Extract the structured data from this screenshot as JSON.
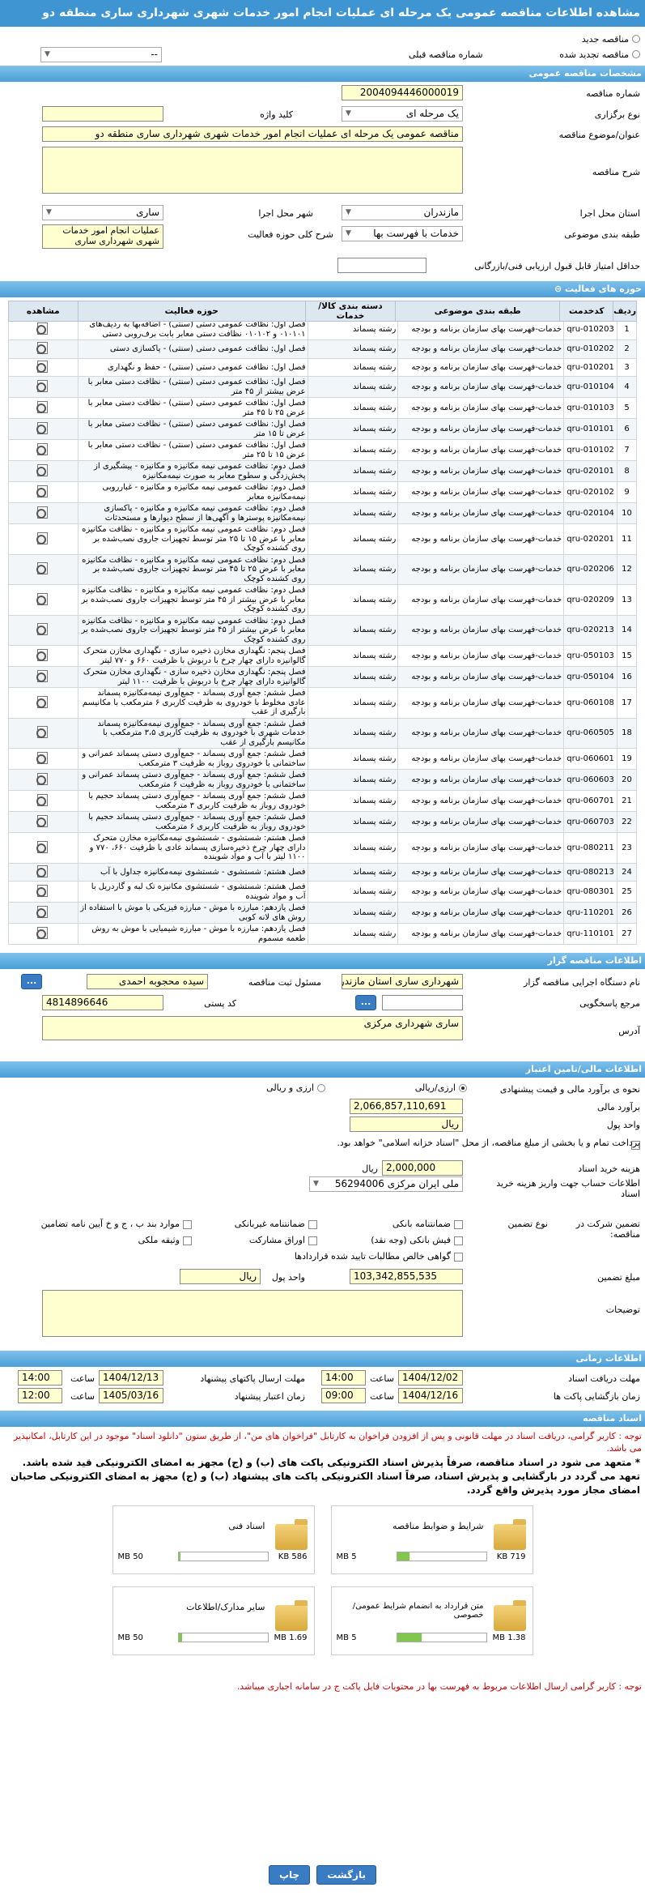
{
  "header": {
    "title": "مشاهده اطلاعات مناقصه عمومی یک مرحله ای عملیات انجام امور خدمات شهری شهرداری ساری منطقه دو"
  },
  "top": {
    "new_label": "مناقصه جدید",
    "renewed_label": "مناقصه تجدید شده",
    "prev_label": "شماره مناقصه قبلی",
    "prev_value": "--"
  },
  "general": {
    "section": "مشخصات مناقصه عمومی",
    "number_label": "شماره مناقصه",
    "number": "2004094446000019",
    "type_label": "نوع برگزاری",
    "type": "یک مرحله ای",
    "keyword_label": "کلید واژه",
    "subject_label": "عنوان/موضوع مناقصه",
    "subject": "مناقصه عمومی یک مرحله ای عملیات انجام امور خدمات شهری شهرداری ساری منطقه دو",
    "desc_label": "شرح مناقصه",
    "province_label": "استان محل اجرا",
    "province": "مازندران",
    "city_label": "شهر محل اجرا",
    "city": "ساری",
    "category_label": "طبقه بندی موضوعی",
    "category": "خدمات با فهرست بها",
    "scope_label": "شرح کلی حوزه فعالیت",
    "scope": "عملیات انجام امور خدمات شهری شهرداری ساری",
    "score_label": "حداقل امتیاز قابل قبول ارزیابی فنی/بازرگانی"
  },
  "activities": {
    "section": "حوزه های فعالیت",
    "headers": [
      "ردیف",
      "کدخدمت",
      "طبقه بندی موضوعی",
      "دسته بندی کالا/خدمات",
      "حوزه فعالیت",
      "مشاهده"
    ],
    "rows": [
      [
        "1",
        "qru-010203",
        "خدمات-فهرست بهای سازمان برنامه و بودجه",
        "رشته پسماند",
        "فصل اول: نظافت عمومی دستی (سنتی) - اضافه‌بها به ردیف‌های ۰۱۰۱۰۱ و ۰۱۰۱۰۲ نظافت دستی معابر بابت برف‌روبی دستی"
      ],
      [
        "2",
        "qru-010202",
        "خدمات-فهرست بهای سازمان برنامه و بودجه",
        "رشته پسماند",
        "فصل اول: نظافت عمومی دستی (سنتی) - پاکسازی دستی"
      ],
      [
        "3",
        "qru-010201",
        "خدمات-فهرست بهای سازمان برنامه و بودجه",
        "رشته پسماند",
        "فصل اول: نظافت عمومی دستی (سنتی) - حفظ و نگهداری"
      ],
      [
        "4",
        "qru-010104",
        "خدمات-فهرست بهای سازمان برنامه و بودجه",
        "رشته پسماند",
        "فصل اول: نظافت عمومی دستی (سنتی) - نظافت دستی معابر با عرض بیشتر از ۴۵ متر"
      ],
      [
        "5",
        "qru-010103",
        "خدمات-فهرست بهای سازمان برنامه و بودجه",
        "رشته پسماند",
        "فصل اول: نظافت عمومی دستی (سنتی) - نظافت دستی معابر با عرض ۲۵ تا ۴۵ متر"
      ],
      [
        "6",
        "qru-010101",
        "خدمات-فهرست بهای سازمان برنامه و بودجه",
        "رشته پسماند",
        "فصل اول: نظافت عمومی دستی (سنتی) - نظافت دستی معابر با عرض تا ۱۵ متر"
      ],
      [
        "7",
        "qru-010102",
        "خدمات-فهرست بهای سازمان برنامه و بودجه",
        "رشته پسماند",
        "فصل اول: نظافت عمومی دستی (سنتی) - نظافت دستی معابر با عرض ۱۵ تا ۲۵ متر"
      ],
      [
        "8",
        "qru-020101",
        "خدمات-فهرست بهای سازمان برنامه و بودجه",
        "رشته پسماند",
        "فصل دوم: نظافت عمومی نیمه مکانیزه و مکانیزه - پیشگیری از پخش‌زدگی و سطوح معابر به صورت نیمه‌مکانیزه"
      ],
      [
        "9",
        "qru-020102",
        "خدمات-فهرست بهای سازمان برنامه و بودجه",
        "رشته پسماند",
        "فصل دوم: نظافت عمومی نیمه مکانیزه و مکانیزه - غبارروبی نیمه‌مکانیزه معابر"
      ],
      [
        "10",
        "qru-020104",
        "خدمات-فهرست بهای سازمان برنامه و بودجه",
        "رشته پسماند",
        "فصل دوم: نظافت عمومی نیمه مکانیزه و مکانیزه - پاکسازی نیمه‌مکانیزه پوسترها و آگهی‌ها از سطح دیوارها و مستحدثات"
      ],
      [
        "11",
        "qru-020201",
        "خدمات-فهرست بهای سازمان برنامه و بودجه",
        "رشته پسماند",
        "فصل دوم: نظافت عمومی نیمه مکانیزه و مکانیزه - نظافت مکانیزه معابر با عرض ۱۵ تا ۲۵ متر توسط تجهیزات جاروی نصب‌شده بر روی کشنده کوچک"
      ],
      [
        "12",
        "qru-020206",
        "خدمات-فهرست بهای سازمان برنامه و بودجه",
        "رشته پسماند",
        "فصل دوم: نظافت عمومی نیمه مکانیزه و مکانیزه - نظافت مکانیزه معابر با عرض ۲۵ تا ۴۵ متر توسط تجهیزات جاروی نصب‌شده بر روی کشنده کوچک"
      ],
      [
        "13",
        "qru-020209",
        "خدمات-فهرست بهای سازمان برنامه و بودجه",
        "رشته پسماند",
        "فصل دوم: نظافت عمومی نیمه مکانیزه و مکانیزه - نظافت مکانیزه معابر با عرض بیشتر از ۴۵ متر توسط تجهیزات جاروی نصب‌شده بر روی کشنده کوچک"
      ],
      [
        "14",
        "qru-020213",
        "خدمات-فهرست بهای سازمان برنامه و بودجه",
        "رشته پسماند",
        "فصل دوم: نظافت عمومی نیمه مکانیزه و مکانیزه - نظافت مکانیزه معابر با عرض بیشتر از ۴۵ متر توسط تجهیزات جاروی نصب‌شده بر روی کشنده کوچک"
      ],
      [
        "15",
        "qru-050103",
        "خدمات-فهرست بهای سازمان برنامه و بودجه",
        "رشته پسماند",
        "فصل پنجم: نگهداری مخازن ذخیره سازی - نگهداری مخازن متحرک گالوانیزه دارای چهار چرخ با دربوش با ظرفیت ۶۶۰ و ۷۷۰ لیتر"
      ],
      [
        "16",
        "qru-050104",
        "خدمات-فهرست بهای سازمان برنامه و بودجه",
        "رشته پسماند",
        "فصل پنجم: نگهداری مخازن ذخیره سازی - نگهداری مخازن متحرک گالوانیزه دارای چهار چرخ با دربوش با ظرفیت ۱۱۰۰ لیتر"
      ],
      [
        "17",
        "qru-060108",
        "خدمات-فهرست بهای سازمان برنامه و بودجه",
        "رشته پسماند",
        "فصل ششم: جمع آوری پسماند - جمع‌آوری نیمه‌مکانیزه پسماند عادی مخلوط با خودروی به ظرفیت کاربری ۶ مترمکعب با مکانیسم بارگیری از عقب"
      ],
      [
        "18",
        "qru-060505",
        "خدمات-فهرست بهای سازمان برنامه و بودجه",
        "رشته پسماند",
        "فصل ششم: جمع آوری پسماند - جمع‌آوری نیمه‌مکانیزه پسماند خدمات شهری با خودروی به ظرفیت کاربری ۳،۵ مترمکعب با مکانیسم بارگیری از عقب"
      ],
      [
        "19",
        "qru-060601",
        "خدمات-فهرست بهای سازمان برنامه و بودجه",
        "رشته پسماند",
        "فصل ششم: جمع آوری پسماند - جمع‌آوری دستی پسماند عمرانی و ساختمانی با خودروی روباز به ظرفیت ۳ مترمکعب"
      ],
      [
        "20",
        "qru-060603",
        "خدمات-فهرست بهای سازمان برنامه و بودجه",
        "رشته پسماند",
        "فصل ششم: جمع آوری پسماند - جمع‌آوری دستی پسماند عمرانی و ساختمانی با خودروی روباز به ظرفیت ۶ مترمکعب"
      ],
      [
        "21",
        "qru-060701",
        "خدمات-فهرست بهای سازمان برنامه و بودجه",
        "رشته پسماند",
        "فصل ششم: جمع آوری پسماند - جمع‌آوری دستی پسماند حجیم با خودروی روباز به ظرفیت کاربری ۳ مترمکعب"
      ],
      [
        "22",
        "qru-060703",
        "خدمات-فهرست بهای سازمان برنامه و بودجه",
        "رشته پسماند",
        "فصل ششم: جمع آوری پسماند - جمع‌آوری دستی پسماند حجیم با خودروی روباز به ظرفیت کاربری ۶ مترمکعب"
      ],
      [
        "23",
        "qru-080211",
        "خدمات-فهرست بهای سازمان برنامه و بودجه",
        "رشته پسماند",
        "فصل هشتم: شستشوی - شستشوی نیمه‌مکانیزه مخازن متحرک دارای چهار چرخ ذخیره‌سازی پسماند عادی با ظرفیت ۶۶۰، ۷۷۰ و ۱۱۰۰ لیتر با آب و مواد شوینده"
      ],
      [
        "24",
        "qru-080213",
        "خدمات-فهرست بهای سازمان برنامه و بودجه",
        "رشته پسماند",
        "فصل هشتم: شستشوی - شستشوی نیمه‌مکانیزه جداول با آب"
      ],
      [
        "25",
        "qru-080301",
        "خدمات-فهرست بهای سازمان برنامه و بودجه",
        "رشته پسماند",
        "فصل هشتم: شستشوی - شستشوی مکانیزه تک لبه و گاردریل با آب و مواد شوینده"
      ],
      [
        "26",
        "qru-110201",
        "خدمات-فهرست بهای سازمان برنامه و بودجه",
        "رشته پسماند",
        "فصل یازدهم: مبارزه با موش - مبارزه فیزیکی با موش با استفاده از روش های لانه کوبی"
      ],
      [
        "27",
        "qru-110101",
        "خدمات-فهرست بهای سازمان برنامه و بودجه",
        "رشته پسماند",
        "فصل یازدهم: مبارزه با موش - مبارزه شیمیایی با موش به روش طعمه مسموم"
      ]
    ]
  },
  "organizer": {
    "section": "اطلاعات مناقصه گزار",
    "org_label": "نام دستگاه اجرایی مناقصه گزار",
    "org": "شهرداری ساری استان مازندران",
    "reg_label": "مسئول ثبت مناقصه",
    "reg": "سیده محجوبه احمدی",
    "ref_label": "مرجع پاسخگویی",
    "postal_label": "کد پستی",
    "postal": "4814896646",
    "address_label": "آدرس",
    "address": "ساری شهرداری مرکزی",
    "dots": "..."
  },
  "finance": {
    "section": "اطلاعات مالی/تامین اعتبار",
    "estimate_label": "نحوه ی برآورد مالی و قیمت پیشنهادی",
    "opt1": "ارزی/ریالی",
    "opt2": "ارزی و ریالی",
    "estimate_amount_label": "برآورد مالی",
    "estimate_amount": "2,066,857,110,691",
    "unit_label": "واحد پول",
    "unit": "ریال",
    "pay_label": "پرداخت تمام و یا بخشی از مبلغ مناقصه، از محل \"اسناد خزانه اسلامی\" خواهد بود.",
    "doc_cost_label": "هزینه خرید اسناد",
    "doc_cost": "2,000,000",
    "doc_cost_unit": "ریال",
    "account_label": "اطلاعات حساب جهت واریز هزینه خرید اسناد",
    "account": "ملی ایران مرکزی 56294006"
  },
  "guarantee": {
    "participation_label": "تضمین شرکت در مناقصه:",
    "type_label": "نوع تضمین",
    "options": [
      "ضمانتنامه بانکی",
      "ضمانتنامه غیربانکی",
      "موارد بند ب ، ج و خ آیین نامه تضامین",
      "فیش بانکی (وجه نقد)",
      "اوراق مشارکت",
      "وثیقه ملکی",
      "گواهی خالص مطالبات تایید شده قراردادها"
    ],
    "amount_label": "مبلغ تضمین",
    "amount": "103,342,855,535",
    "unit_label": "واحد پول",
    "unit": "ریال",
    "notes_label": "توضیحات"
  },
  "timing": {
    "section": "اطلاعات زمانی",
    "recv_label": "مهلت دریافت اسناد",
    "recv_date": "1404/12/02",
    "recv_time": "14:00",
    "send_label": "مهلت ارسال پاکتهای پیشنهاد",
    "send_date": "1404/12/13",
    "send_time": "14:00",
    "open_label": "زمان بازگشایی پاکت ها",
    "open_date": "1404/12/16",
    "open_time": "09:00",
    "valid_label": "زمان اعتبار پیشنهاد",
    "valid_date": "1405/03/16",
    "valid_time": "12:00",
    "time_label": "ساعت"
  },
  "docs": {
    "section": "اسناد مناقصه",
    "note1": "توجه : کاربر گرامی، دریافت اسناد در مهلت قانونی و پس از افزودن فراخوان به کارتابل \"فراخوان های من\"، از طریق ستون \"دانلود اسناد\" موجود در این کارتابل، امکانپذیر می باشد.",
    "note2": "* متعهد می شود در اسناد مناقصه، صرفاً پذیرش اسناد الکترونیکی پاکت های (ب) و (ج) مجهز به امضای الکترونیکی قید شده باشد. تعهد می گردد در بارگشایی و پذیرش اسناد، صرفاً اسناد الکترونیکی پاکت های پیشنهاد (ب) و (ج) مجهز به امضای الکترونیکی صاحبان امضای مجاز مورد پذیرش واقع گردد.",
    "files": [
      {
        "name": "شرایط و ضوابط مناقصه",
        "size": "719 KB",
        "max": "5 MB",
        "fill": 0.14
      },
      {
        "name": "اسناد فنی",
        "size": "586 KB",
        "max": "50 MB",
        "fill": 0.02
      },
      {
        "name": "متن قرارداد به انضمام شرایط عمومی/خصوصی",
        "size": "1.38 MB",
        "max": "5 MB",
        "fill": 0.28
      },
      {
        "name": "سایر مدارک/اطلاعات",
        "size": "1.69 MB",
        "max": "50 MB",
        "fill": 0.04
      }
    ],
    "note3": "توجه : کاربر گرامی ارسال اطلاعات مربوط به فهرست بها در محتویات فایل پاکت ج در سامانه اجباری میباشد."
  },
  "footer": {
    "print": "چاپ",
    "back": "بازگشت"
  },
  "colors": {
    "header": "#3f95d1",
    "field": "#ffffd0",
    "note": "#cc0000"
  }
}
